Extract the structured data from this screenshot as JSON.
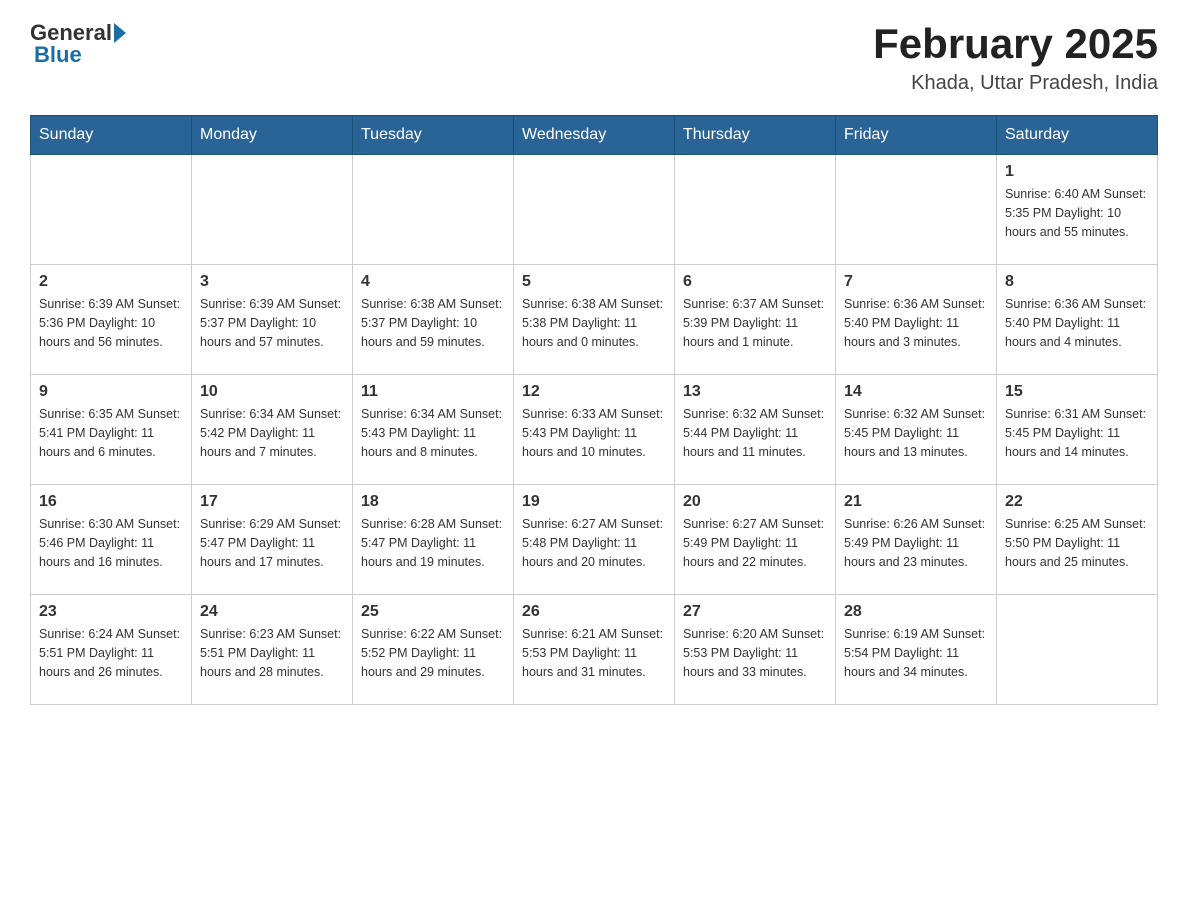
{
  "header": {
    "logo_general": "General",
    "logo_blue": "Blue",
    "title": "February 2025",
    "location": "Khada, Uttar Pradesh, India"
  },
  "days_of_week": [
    "Sunday",
    "Monday",
    "Tuesday",
    "Wednesday",
    "Thursday",
    "Friday",
    "Saturday"
  ],
  "weeks": [
    [
      {
        "day": "",
        "info": ""
      },
      {
        "day": "",
        "info": ""
      },
      {
        "day": "",
        "info": ""
      },
      {
        "day": "",
        "info": ""
      },
      {
        "day": "",
        "info": ""
      },
      {
        "day": "",
        "info": ""
      },
      {
        "day": "1",
        "info": "Sunrise: 6:40 AM\nSunset: 5:35 PM\nDaylight: 10 hours and 55 minutes."
      }
    ],
    [
      {
        "day": "2",
        "info": "Sunrise: 6:39 AM\nSunset: 5:36 PM\nDaylight: 10 hours and 56 minutes."
      },
      {
        "day": "3",
        "info": "Sunrise: 6:39 AM\nSunset: 5:37 PM\nDaylight: 10 hours and 57 minutes."
      },
      {
        "day": "4",
        "info": "Sunrise: 6:38 AM\nSunset: 5:37 PM\nDaylight: 10 hours and 59 minutes."
      },
      {
        "day": "5",
        "info": "Sunrise: 6:38 AM\nSunset: 5:38 PM\nDaylight: 11 hours and 0 minutes."
      },
      {
        "day": "6",
        "info": "Sunrise: 6:37 AM\nSunset: 5:39 PM\nDaylight: 11 hours and 1 minute."
      },
      {
        "day": "7",
        "info": "Sunrise: 6:36 AM\nSunset: 5:40 PM\nDaylight: 11 hours and 3 minutes."
      },
      {
        "day": "8",
        "info": "Sunrise: 6:36 AM\nSunset: 5:40 PM\nDaylight: 11 hours and 4 minutes."
      }
    ],
    [
      {
        "day": "9",
        "info": "Sunrise: 6:35 AM\nSunset: 5:41 PM\nDaylight: 11 hours and 6 minutes."
      },
      {
        "day": "10",
        "info": "Sunrise: 6:34 AM\nSunset: 5:42 PM\nDaylight: 11 hours and 7 minutes."
      },
      {
        "day": "11",
        "info": "Sunrise: 6:34 AM\nSunset: 5:43 PM\nDaylight: 11 hours and 8 minutes."
      },
      {
        "day": "12",
        "info": "Sunrise: 6:33 AM\nSunset: 5:43 PM\nDaylight: 11 hours and 10 minutes."
      },
      {
        "day": "13",
        "info": "Sunrise: 6:32 AM\nSunset: 5:44 PM\nDaylight: 11 hours and 11 minutes."
      },
      {
        "day": "14",
        "info": "Sunrise: 6:32 AM\nSunset: 5:45 PM\nDaylight: 11 hours and 13 minutes."
      },
      {
        "day": "15",
        "info": "Sunrise: 6:31 AM\nSunset: 5:45 PM\nDaylight: 11 hours and 14 minutes."
      }
    ],
    [
      {
        "day": "16",
        "info": "Sunrise: 6:30 AM\nSunset: 5:46 PM\nDaylight: 11 hours and 16 minutes."
      },
      {
        "day": "17",
        "info": "Sunrise: 6:29 AM\nSunset: 5:47 PM\nDaylight: 11 hours and 17 minutes."
      },
      {
        "day": "18",
        "info": "Sunrise: 6:28 AM\nSunset: 5:47 PM\nDaylight: 11 hours and 19 minutes."
      },
      {
        "day": "19",
        "info": "Sunrise: 6:27 AM\nSunset: 5:48 PM\nDaylight: 11 hours and 20 minutes."
      },
      {
        "day": "20",
        "info": "Sunrise: 6:27 AM\nSunset: 5:49 PM\nDaylight: 11 hours and 22 minutes."
      },
      {
        "day": "21",
        "info": "Sunrise: 6:26 AM\nSunset: 5:49 PM\nDaylight: 11 hours and 23 minutes."
      },
      {
        "day": "22",
        "info": "Sunrise: 6:25 AM\nSunset: 5:50 PM\nDaylight: 11 hours and 25 minutes."
      }
    ],
    [
      {
        "day": "23",
        "info": "Sunrise: 6:24 AM\nSunset: 5:51 PM\nDaylight: 11 hours and 26 minutes."
      },
      {
        "day": "24",
        "info": "Sunrise: 6:23 AM\nSunset: 5:51 PM\nDaylight: 11 hours and 28 minutes."
      },
      {
        "day": "25",
        "info": "Sunrise: 6:22 AM\nSunset: 5:52 PM\nDaylight: 11 hours and 29 minutes."
      },
      {
        "day": "26",
        "info": "Sunrise: 6:21 AM\nSunset: 5:53 PM\nDaylight: 11 hours and 31 minutes."
      },
      {
        "day": "27",
        "info": "Sunrise: 6:20 AM\nSunset: 5:53 PM\nDaylight: 11 hours and 33 minutes."
      },
      {
        "day": "28",
        "info": "Sunrise: 6:19 AM\nSunset: 5:54 PM\nDaylight: 11 hours and 34 minutes."
      },
      {
        "day": "",
        "info": ""
      }
    ]
  ]
}
